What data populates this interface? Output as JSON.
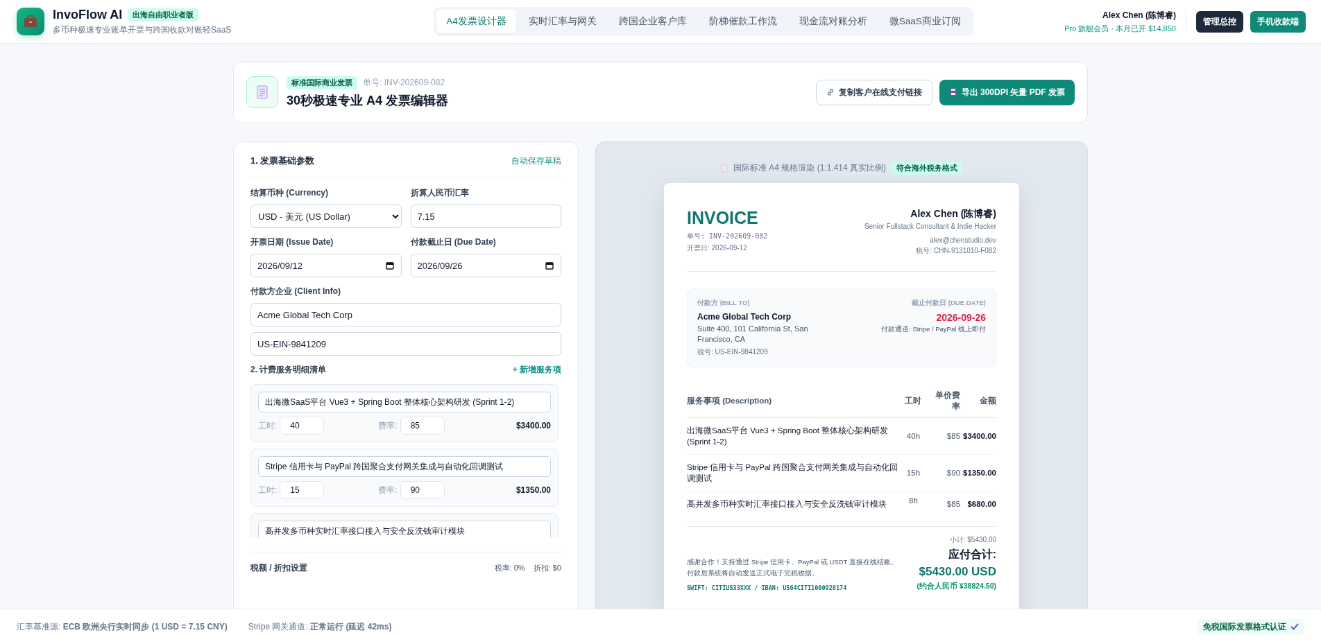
{
  "header": {
    "app_name": "InvoFlow AI",
    "badge": "出海自由职业者版",
    "subtitle": "多币种极速专业账单开票与跨国收款对账轻SaaS",
    "tabs": [
      {
        "label": "A4发票设计器",
        "selected": true
      },
      {
        "label": "实时汇率与网关",
        "selected": false
      },
      {
        "label": "跨国企业客户库",
        "selected": false
      },
      {
        "label": "阶梯催款工作流",
        "selected": false
      },
      {
        "label": "现金流对账分析",
        "selected": false
      },
      {
        "label": "微SaaS商业订阅",
        "selected": false
      }
    ],
    "user_name": "Alex Chen (陈博睿)",
    "plan": "Pro 旗舰会员 · 本月已开 $14,850",
    "buttons": [
      {
        "label": "管理总控",
        "kind": "dark"
      },
      {
        "label": "手机收款端",
        "kind": "primary"
      }
    ]
  },
  "editor_card": {
    "tag": "标准国际商业发票",
    "number": "单号: INV-202609-082",
    "title": "30秒极速专业 A4 发票编辑器",
    "buttons": [
      {
        "label": "复制客户在线支付链接",
        "kind": "outline"
      },
      {
        "label": "导出 300DPI 矢量 PDF 发票",
        "kind": "primary"
      }
    ]
  },
  "form": {
    "section_1": "1. 发票基础参数",
    "autosave": "自动保存草稿",
    "currency": {
      "label": "结算币种 (Currency)",
      "value": "USD - 美元 (US Dollar)"
    },
    "rate": {
      "label": "折算人民币汇率",
      "value": "7.15"
    },
    "issue_date": {
      "label": "开票日期 (Issue Date)",
      "value": "2026/09/12"
    },
    "due_date": {
      "label": "付款截止日 (Due Date)",
      "value": "2026/09/26"
    },
    "client": {
      "label": "付款方企业 (Client Info)",
      "name": "Acme Global Tech Corp",
      "tax_id": "US-EIN-9841209"
    },
    "section_2": "2. 计费服务明细清单",
    "add_item": "+ 新增服务项",
    "items": [
      {
        "description": "出海微SaaS平台 Vue3 + Spring Boot 整体核心架构研发 (Sprint 1-2)",
        "hours_label": "工时:",
        "hours": "40",
        "rate_label": "费率:",
        "rate": "85",
        "amount": "$3400.00"
      },
      {
        "description": "Stripe 信用卡与 PayPal 跨国聚合支付网关集成与自动化回调测试",
        "hours_label": "工时:",
        "hours": "15",
        "rate_label": "费率:",
        "rate": "90",
        "amount": "$1350.00"
      },
      {
        "description": "高并发多币种实时汇率接口接入与安全反洗钱审计模块"
      }
    ],
    "tax_label": "税额 / 折扣设置",
    "tax_rate": "税率: 0%",
    "discount": "折扣: $0"
  },
  "preview": {
    "caption": "国际标准 A4 规格渲染 (1:1.414 真实比例)",
    "badge": "符合海外税务格式",
    "invoice": {
      "title": "INVOICE",
      "number": "单号: INV-202609-082",
      "issued": "开票日: 2026-09-12",
      "seller": {
        "name": "Alex Chen (陈博睿)",
        "role": "Senior Fullstack Consultant & Indie Hacker",
        "email": "alex@chenstudio.dev",
        "tax_id": "税号: CHN-9131010-F082"
      },
      "bill_to": {
        "label": "付款方 (BILL TO)",
        "company": "Acme Global Tech Corp",
        "address": "Suite 400, 101 California St, San Francisco, CA",
        "tax_id": "税号: US-EIN-9841209"
      },
      "due": {
        "label": "截止付款日 (DUE DATE)",
        "date": "2026-09-26",
        "channel": "付款通道: Stripe / PayPal 线上即付"
      },
      "columns": [
        "服务事项 (Description)",
        "工时",
        "单价费率",
        "金额"
      ],
      "rows": [
        {
          "description": "出海微SaaS平台 Vue3 + Spring Boot 整体核心架构研发 (Sprint 1-2)",
          "hours": "40h",
          "rate": "$85",
          "amount": "$3400.00"
        },
        {
          "description": "Stripe 信用卡与 PayPal 跨国聚合支付网关集成与自动化回调测试",
          "hours": "15h",
          "rate": "$90",
          "amount": "$1350.00"
        },
        {
          "description": "高并发多币种实时汇率接口接入与安全反洗钱审计模块",
          "hours": "8h",
          "rate": "$85",
          "amount": "$680.00"
        }
      ],
      "note": "感谢合作！支持通过 Stripe 信用卡、PayPal 或 USDT 直接在线结账。付款后系统将自动发送正式电子完税收据。",
      "bank": "SWIFT: CITIUS33XXX / IBAN: US64CITI1000928174",
      "subtotal": "小计: $5430.00",
      "total_label": "应付合计:",
      "total": "$5430.00 USD",
      "total_cny": "(约合人民币 ¥38824.50)"
    }
  },
  "footer": {
    "rate_source": "汇率基准源: **ECB 欧洲央行实时同步 (1 USD = 7.15 CNY)**",
    "gateway": "Stripe 网关通道: **正常运行 (延迟 42ms)**",
    "cert": "免税国际发票格式认证"
  }
}
